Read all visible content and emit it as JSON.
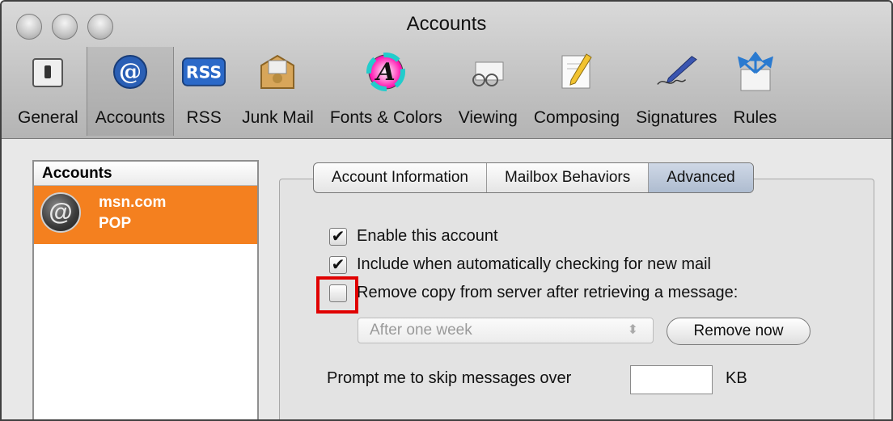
{
  "window": {
    "title": "Accounts"
  },
  "toolbar": {
    "items": [
      {
        "label": "General",
        "icon": "switch-icon"
      },
      {
        "label": "Accounts",
        "icon": "at-sign-icon",
        "selected": true
      },
      {
        "label": "RSS",
        "icon": "rss-icon"
      },
      {
        "label": "Junk Mail",
        "icon": "junk-mail-icon"
      },
      {
        "label": "Fonts & Colors",
        "icon": "fonts-colors-icon"
      },
      {
        "label": "Viewing",
        "icon": "viewing-icon"
      },
      {
        "label": "Composing",
        "icon": "composing-icon"
      },
      {
        "label": "Signatures",
        "icon": "signature-pen-icon"
      },
      {
        "label": "Rules",
        "icon": "rules-arrows-icon"
      }
    ]
  },
  "accounts_list": {
    "header": "Accounts",
    "items": [
      {
        "name": "msn.com",
        "type": "POP",
        "selected": true
      }
    ]
  },
  "tabs": [
    {
      "label": "Account Information"
    },
    {
      "label": "Mailbox Behaviors"
    },
    {
      "label": "Advanced",
      "active": true
    }
  ],
  "advanced": {
    "enable_account": {
      "label": "Enable this account",
      "checked": true
    },
    "include_check": {
      "label": "Include when automatically checking for new mail",
      "checked": true
    },
    "remove_copy": {
      "label": "Remove copy from server after retrieving a message:",
      "checked": false
    },
    "remove_after": {
      "value": "After one week"
    },
    "remove_now_button": "Remove now",
    "prompt_label": "Prompt me to skip messages over",
    "prompt_value": "",
    "prompt_unit": "KB"
  },
  "colors": {
    "selection": "#f4801f",
    "highlight_box": "#e00000"
  }
}
